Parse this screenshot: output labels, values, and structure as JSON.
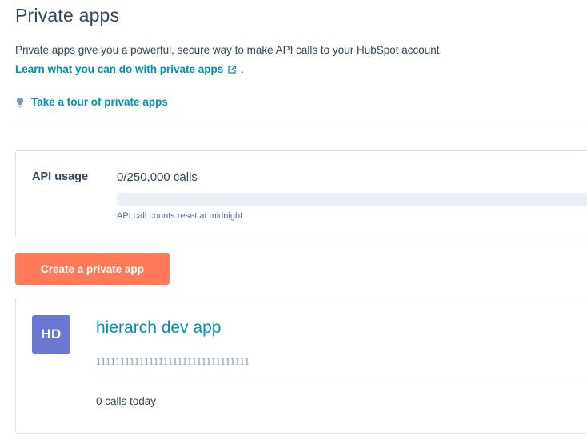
{
  "page": {
    "title": "Private apps",
    "description": "Private apps give you a powerful, secure way to make API calls to your HubSpot account.",
    "learn_link": "Learn what you can do with private apps",
    "learn_link_suffix": ".",
    "learn_link_icon": "external-link-icon",
    "tour_link": "Take a tour of private apps",
    "tour_icon": "lightbulb-icon"
  },
  "usage": {
    "label": "API usage",
    "value": "0/250,000 calls",
    "progress_fraction": 0,
    "note": "API call counts reset at midnight"
  },
  "actions": {
    "create_label": "Create a private app"
  },
  "apps": [
    {
      "initials": "HD",
      "name": "hierarch dev app",
      "id": "11111111111111111111111111111111",
      "calls": "0 calls today"
    }
  ],
  "colors": {
    "accent": "#0091ae",
    "button": "#ff7a59",
    "avatar": "#6a78d1",
    "text": "#33475b"
  }
}
